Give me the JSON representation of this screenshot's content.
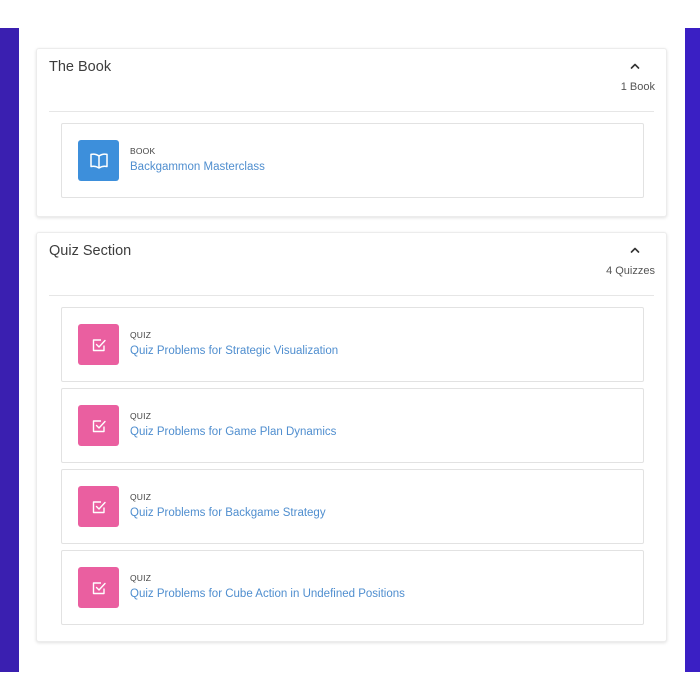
{
  "colors": {
    "accent_bar": "#3a1fb0",
    "book_tile": "#3d8fdb",
    "quiz_tile": "#ea5fa0",
    "link": "#4f8ecf"
  },
  "book_section": {
    "title": "The Book",
    "count": "1 Book",
    "items": [
      {
        "kind": "BOOK",
        "title": "Backgammon Masterclass",
        "icon": "open-book-icon"
      }
    ]
  },
  "quiz_section": {
    "title": "Quiz Section",
    "count": "4 Quizzes",
    "items": [
      {
        "kind": "QUIZ",
        "title": "Quiz Problems for Strategic Visualization",
        "icon": "checkbox-icon"
      },
      {
        "kind": "QUIZ",
        "title": "Quiz Problems for Game Plan Dynamics",
        "icon": "checkbox-icon"
      },
      {
        "kind": "QUIZ",
        "title": "Quiz Problems for Backgame Strategy",
        "icon": "checkbox-icon"
      },
      {
        "kind": "QUIZ",
        "title": "Quiz Problems for Cube Action in Undefined Positions",
        "icon": "checkbox-icon"
      }
    ]
  }
}
